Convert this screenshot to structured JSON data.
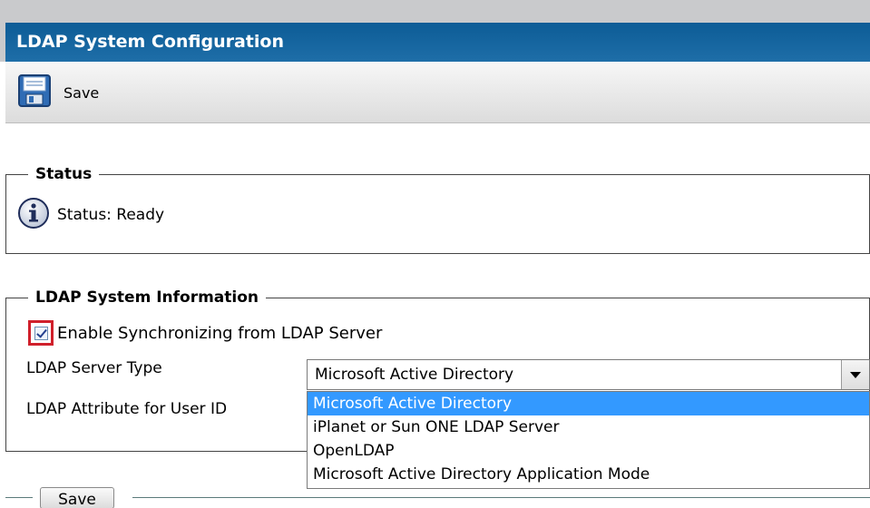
{
  "header": {
    "title": "LDAP System Configuration"
  },
  "toolbar": {
    "save_label": "Save",
    "save_icon": "floppy-disk-icon"
  },
  "status": {
    "legend": "Status",
    "icon": "info-icon",
    "text": "Status: Ready"
  },
  "ldap": {
    "legend": "LDAP System Information",
    "enable_label": "Enable Synchronizing from LDAP Server",
    "enable_checked": true,
    "server_type_label": "LDAP Server Type",
    "attribute_label": "LDAP Attribute for User ID",
    "server_type_value": "Microsoft Active Directory",
    "options": [
      "Microsoft Active Directory",
      "iPlanet or Sun ONE LDAP Server",
      "OpenLDAP",
      "Microsoft Active Directory Application Mode"
    ],
    "highlighted_option": "Microsoft Active Directory"
  },
  "footer": {
    "save_label": "Save"
  },
  "colors": {
    "title_bar": "#1e6ea8",
    "highlight": "#3399ff",
    "checkbox_frame": "#d0202b"
  }
}
